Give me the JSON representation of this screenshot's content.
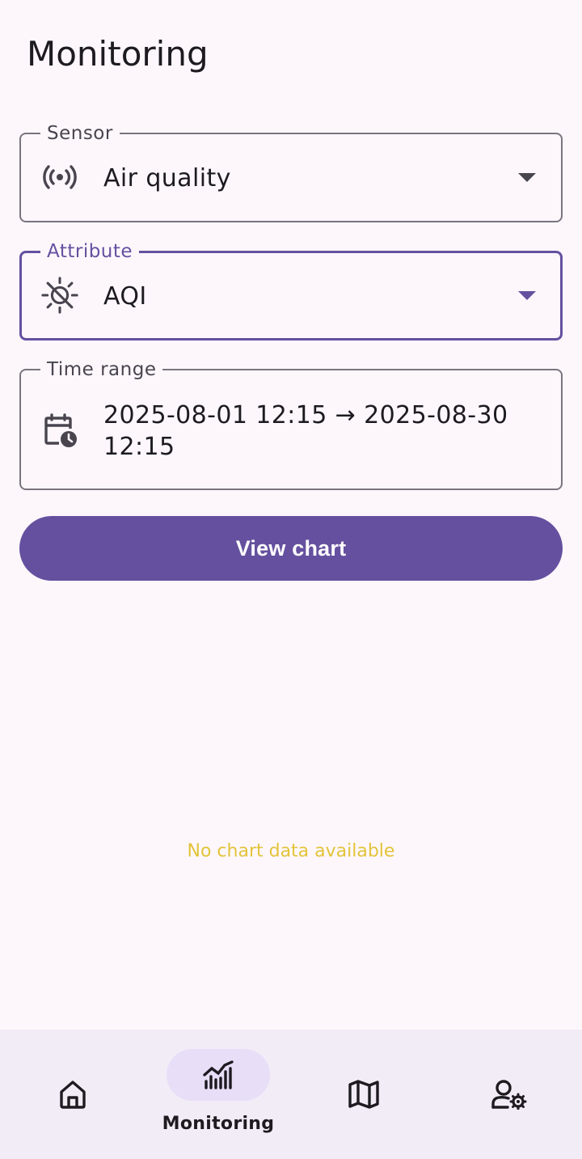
{
  "header": {
    "title": "Monitoring"
  },
  "form": {
    "sensor": {
      "label": "Sensor",
      "value": "Air quality",
      "icon": "sensors-icon"
    },
    "attribute": {
      "label": "Attribute",
      "value": "AQI",
      "icon": "air-quality-icon"
    },
    "time_range": {
      "label": "Time range",
      "value_line1": "2025-08-01 12:15 → 2025-08-30",
      "value_line2": "12:15",
      "icon": "calendar-clock-icon"
    },
    "submit_label": "View chart"
  },
  "chart": {
    "empty_message": "No chart data available"
  },
  "bottom_nav": {
    "items": [
      {
        "icon": "home-icon",
        "label": "",
        "active": false
      },
      {
        "icon": "chart-icon",
        "label": "Monitoring",
        "active": true
      },
      {
        "icon": "map-icon",
        "label": "",
        "active": false
      },
      {
        "icon": "user-settings-icon",
        "label": "",
        "active": false
      }
    ]
  },
  "colors": {
    "primary": "#65509f",
    "background": "#fdf7fc",
    "nav_background": "#f2ecf6",
    "active_indicator": "#e8def8",
    "empty_text": "#e3c43a",
    "outline": "#79747e"
  }
}
